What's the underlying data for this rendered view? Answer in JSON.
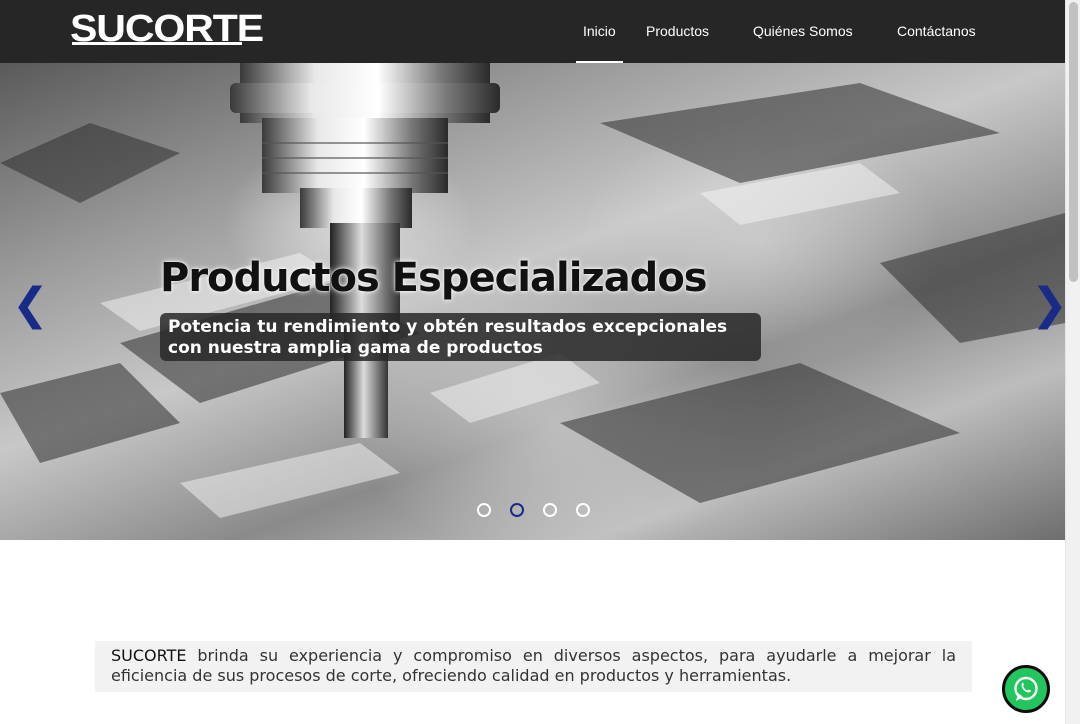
{
  "brand": {
    "logo_text": "SUCORTE"
  },
  "nav": {
    "items": [
      {
        "label": "Inicio",
        "active": true
      },
      {
        "label": "Productos",
        "active": false
      },
      {
        "label": "Quiénes Somos",
        "active": false
      },
      {
        "label": "Contáctanos",
        "active": false
      }
    ]
  },
  "hero": {
    "title": "Productos Especializados",
    "subtitle": "Potencia tu rendimiento y obtén resultados excepcionales con nuestra amplia gama de productos",
    "prev_glyph": "❮",
    "next_glyph": "❯",
    "slide_count": 4,
    "active_slide": 2
  },
  "intro": {
    "brand": "SUCORTE",
    "text": " brinda su experiencia y compromiso en diversos aspectos, para ayudarle a mejorar la eficiencia de sus procesos de corte, ofreciendo calidad en productos y herramientas."
  },
  "floating": {
    "whatsapp_icon": "whatsapp-icon"
  },
  "colors": {
    "navbar": "#262626",
    "accent": "#1a2a88",
    "whatsapp": "#22c55e"
  }
}
